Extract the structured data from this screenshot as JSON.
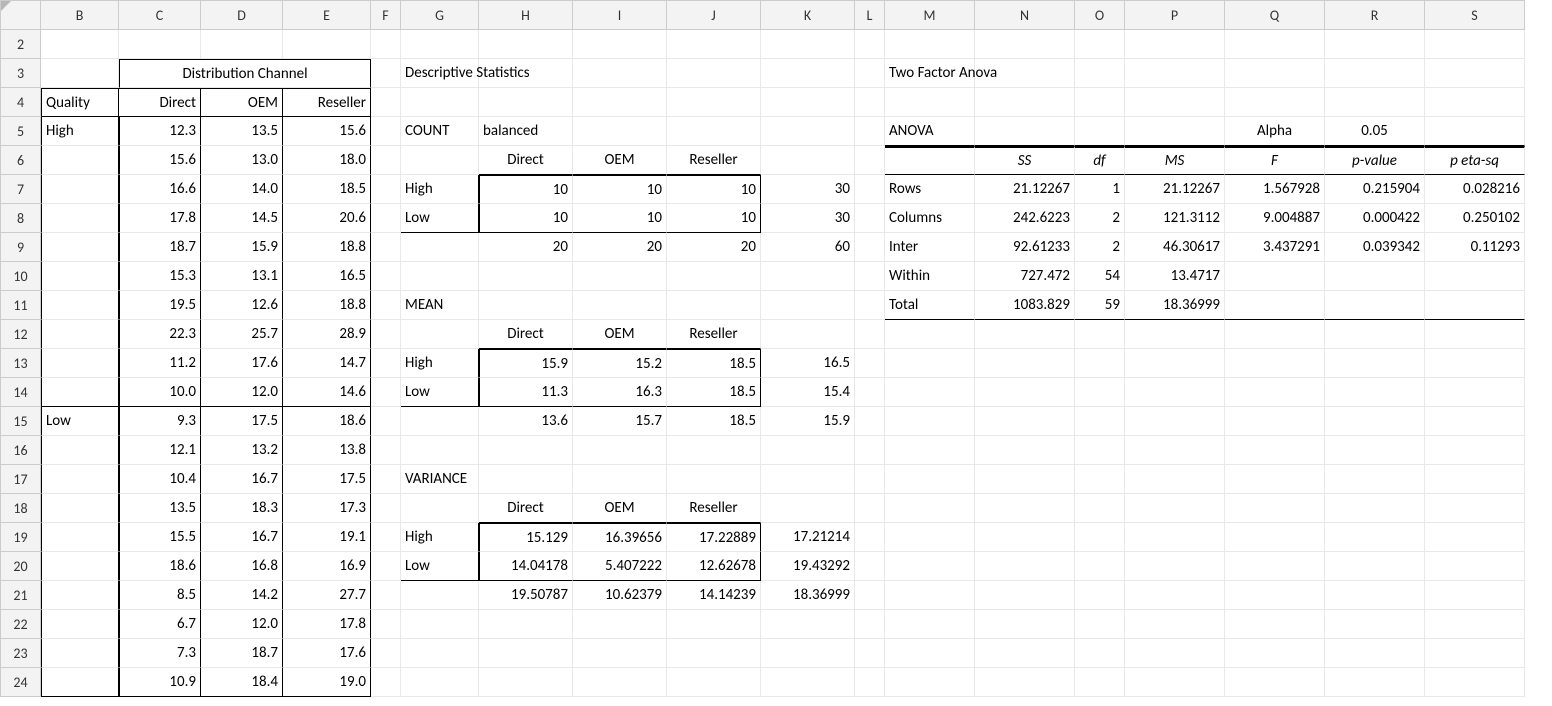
{
  "colHeaders": [
    "",
    "B",
    "C",
    "D",
    "E",
    "F",
    "G",
    "H",
    "I",
    "J",
    "K",
    "L",
    "M",
    "N",
    "O",
    "P",
    "Q",
    "R",
    "S"
  ],
  "rowHeaders": [
    "2",
    "3",
    "4",
    "5",
    "6",
    "7",
    "8",
    "9",
    "10",
    "11",
    "12",
    "13",
    "14",
    "15",
    "16",
    "17",
    "18",
    "19",
    "20",
    "21",
    "22",
    "23",
    "24"
  ],
  "titles": {
    "distChannel": "Distribution Channel",
    "quality": "Quality",
    "direct": "Direct",
    "oem": "OEM",
    "reseller": "Reseller",
    "high": "High",
    "low": "Low",
    "descStats": "Descriptive Statistics",
    "count": "COUNT",
    "balanced": "balanced",
    "mean": "MEAN",
    "variance": "VARIANCE",
    "twoFactor": "Two Factor Anova",
    "anova": "ANOVA",
    "alpha": "Alpha",
    "alphaVal": "0.05",
    "SS": "SS",
    "df": "df",
    "MS": "MS",
    "F": "F",
    "pvalue": "p-value",
    "peta": "p eta-sq",
    "rows": "Rows",
    "columns": "Columns",
    "inter": "Inter",
    "within": "Within",
    "total": "Total"
  },
  "data": {
    "highC": [
      "12.3",
      "15.6",
      "16.6",
      "17.8",
      "18.7",
      "15.3",
      "19.5",
      "22.3",
      "11.2",
      "10.0"
    ],
    "highD": [
      "13.5",
      "13.0",
      "14.0",
      "14.5",
      "15.9",
      "13.1",
      "12.6",
      "25.7",
      "17.6",
      "12.0"
    ],
    "highE": [
      "15.6",
      "18.0",
      "18.5",
      "20.6",
      "18.8",
      "16.5",
      "18.8",
      "28.9",
      "14.7",
      "14.6"
    ],
    "lowC": [
      "9.3",
      "12.1",
      "10.4",
      "13.5",
      "15.5",
      "18.6",
      "8.5",
      "6.7",
      "7.3",
      "10.9"
    ],
    "lowD": [
      "17.5",
      "13.2",
      "16.7",
      "18.3",
      "16.7",
      "16.8",
      "14.2",
      "12.0",
      "18.7",
      "18.4"
    ],
    "lowE": [
      "18.6",
      "13.8",
      "17.5",
      "17.3",
      "19.1",
      "16.9",
      "27.7",
      "17.8",
      "17.6",
      "19.0"
    ]
  },
  "count": {
    "hdr": [
      "Direct",
      "OEM",
      "Reseller"
    ],
    "high": [
      "10",
      "10",
      "10",
      "30"
    ],
    "low": [
      "10",
      "10",
      "10",
      "30"
    ],
    "tot": [
      "20",
      "20",
      "20",
      "60"
    ]
  },
  "mean": {
    "hdr": [
      "Direct",
      "OEM",
      "Reseller"
    ],
    "high": [
      "15.9",
      "15.2",
      "18.5",
      "16.5"
    ],
    "low": [
      "11.3",
      "16.3",
      "18.5",
      "15.4"
    ],
    "tot": [
      "13.6",
      "15.7",
      "18.5",
      "15.9"
    ]
  },
  "variance": {
    "hdr": [
      "Direct",
      "OEM",
      "Reseller"
    ],
    "high": [
      "15.129",
      "16.39656",
      "17.22889",
      "17.21214"
    ],
    "low": [
      "14.04178",
      "5.407222",
      "12.62678",
      "19.43292"
    ],
    "tot": [
      "19.50787",
      "10.62379",
      "14.14239",
      "18.36999"
    ]
  },
  "anova": {
    "rows": {
      "SS": "21.12267",
      "df": "1",
      "MS": "21.12267",
      "F": "1.567928",
      "p": "0.215904",
      "eta": "0.028216"
    },
    "columns": {
      "SS": "242.6223",
      "df": "2",
      "MS": "121.3112",
      "F": "9.004887",
      "p": "0.000422",
      "eta": "0.250102"
    },
    "inter": {
      "SS": "92.61233",
      "df": "2",
      "MS": "46.30617",
      "F": "3.437291",
      "p": "0.039342",
      "eta": "0.11293"
    },
    "within": {
      "SS": "727.472",
      "df": "54",
      "MS": "13.4717"
    },
    "total": {
      "SS": "1083.829",
      "df": "59",
      "MS": "18.36999"
    }
  }
}
